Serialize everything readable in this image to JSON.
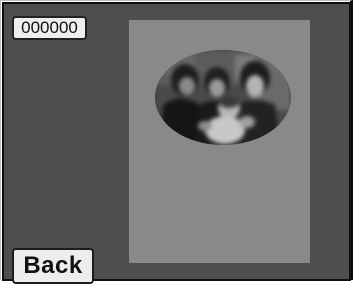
{
  "counter": {
    "value": "000000"
  },
  "photo": {
    "description_icon": "family-photo"
  },
  "navigation": {
    "back_label": "Back"
  },
  "colors": {
    "screen_background": "#4e4e4e",
    "paper": "#898989",
    "button_face": "#ededed"
  }
}
